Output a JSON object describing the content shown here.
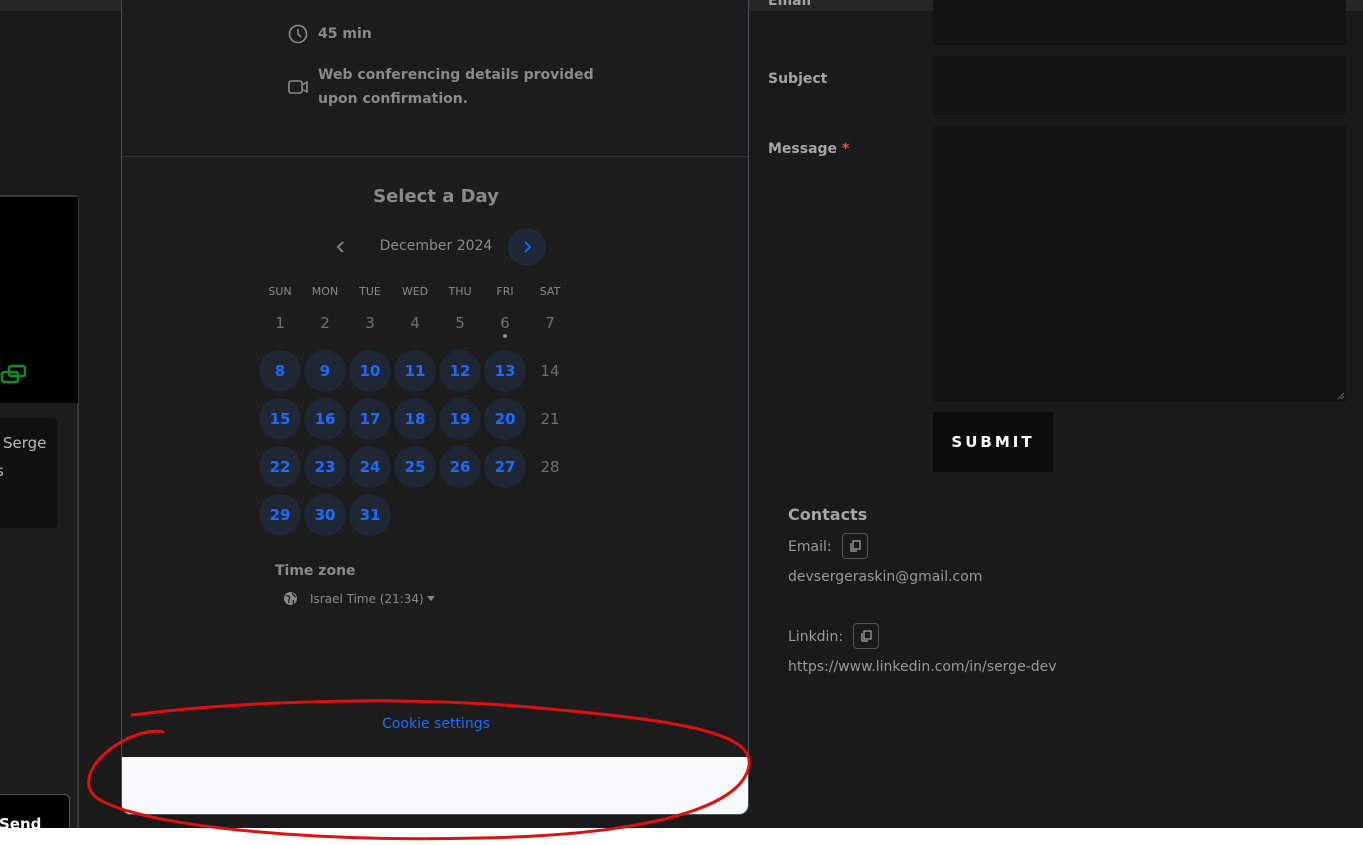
{
  "event": {
    "duration": "45 min",
    "conferencing_line1": "Web conferencing details provided",
    "conferencing_line2": "upon confirmation."
  },
  "calendar": {
    "title": "Select a Day",
    "month": "December 2024",
    "weekdays": [
      "SUN",
      "MON",
      "TUE",
      "WED",
      "THU",
      "FRI",
      "SAT"
    ],
    "days": [
      {
        "n": "1",
        "available": false
      },
      {
        "n": "2",
        "available": false
      },
      {
        "n": "3",
        "available": false
      },
      {
        "n": "4",
        "available": false
      },
      {
        "n": "5",
        "available": false
      },
      {
        "n": "6",
        "available": false,
        "today": true
      },
      {
        "n": "7",
        "available": false
      },
      {
        "n": "8",
        "available": true
      },
      {
        "n": "9",
        "available": true
      },
      {
        "n": "10",
        "available": true
      },
      {
        "n": "11",
        "available": true
      },
      {
        "n": "12",
        "available": true
      },
      {
        "n": "13",
        "available": true
      },
      {
        "n": "14",
        "available": false
      },
      {
        "n": "15",
        "available": true
      },
      {
        "n": "16",
        "available": true
      },
      {
        "n": "17",
        "available": true
      },
      {
        "n": "18",
        "available": true
      },
      {
        "n": "19",
        "available": true
      },
      {
        "n": "20",
        "available": true
      },
      {
        "n": "21",
        "available": false
      },
      {
        "n": "22",
        "available": true
      },
      {
        "n": "23",
        "available": true
      },
      {
        "n": "24",
        "available": true
      },
      {
        "n": "25",
        "available": true
      },
      {
        "n": "26",
        "available": true
      },
      {
        "n": "27",
        "available": true
      },
      {
        "n": "28",
        "available": false
      },
      {
        "n": "29",
        "available": true
      },
      {
        "n": "30",
        "available": true
      },
      {
        "n": "31",
        "available": true
      }
    ],
    "timezone_label": "Time zone",
    "timezone_value": "Israel Time (21:34)",
    "cookie_settings": "Cookie settings"
  },
  "form": {
    "email_label": "Email",
    "subject_label": "Subject",
    "message_label": "Message",
    "required_mark": "*",
    "submit_label": "SUBMIT"
  },
  "contacts": {
    "title": "Contacts",
    "email_label": "Email:",
    "email_value": "devsergeraskin@gmail.com",
    "linkedin_label": "Linkdin:",
    "linkedin_value": "https://www.linkedin.com/in/serge-dev"
  },
  "chat": {
    "message_fragment": "Serge",
    "message_fragment2": "s",
    "send_label": "Send"
  },
  "colors": {
    "accent": "#1a6bff",
    "annotation": "#e01010"
  }
}
